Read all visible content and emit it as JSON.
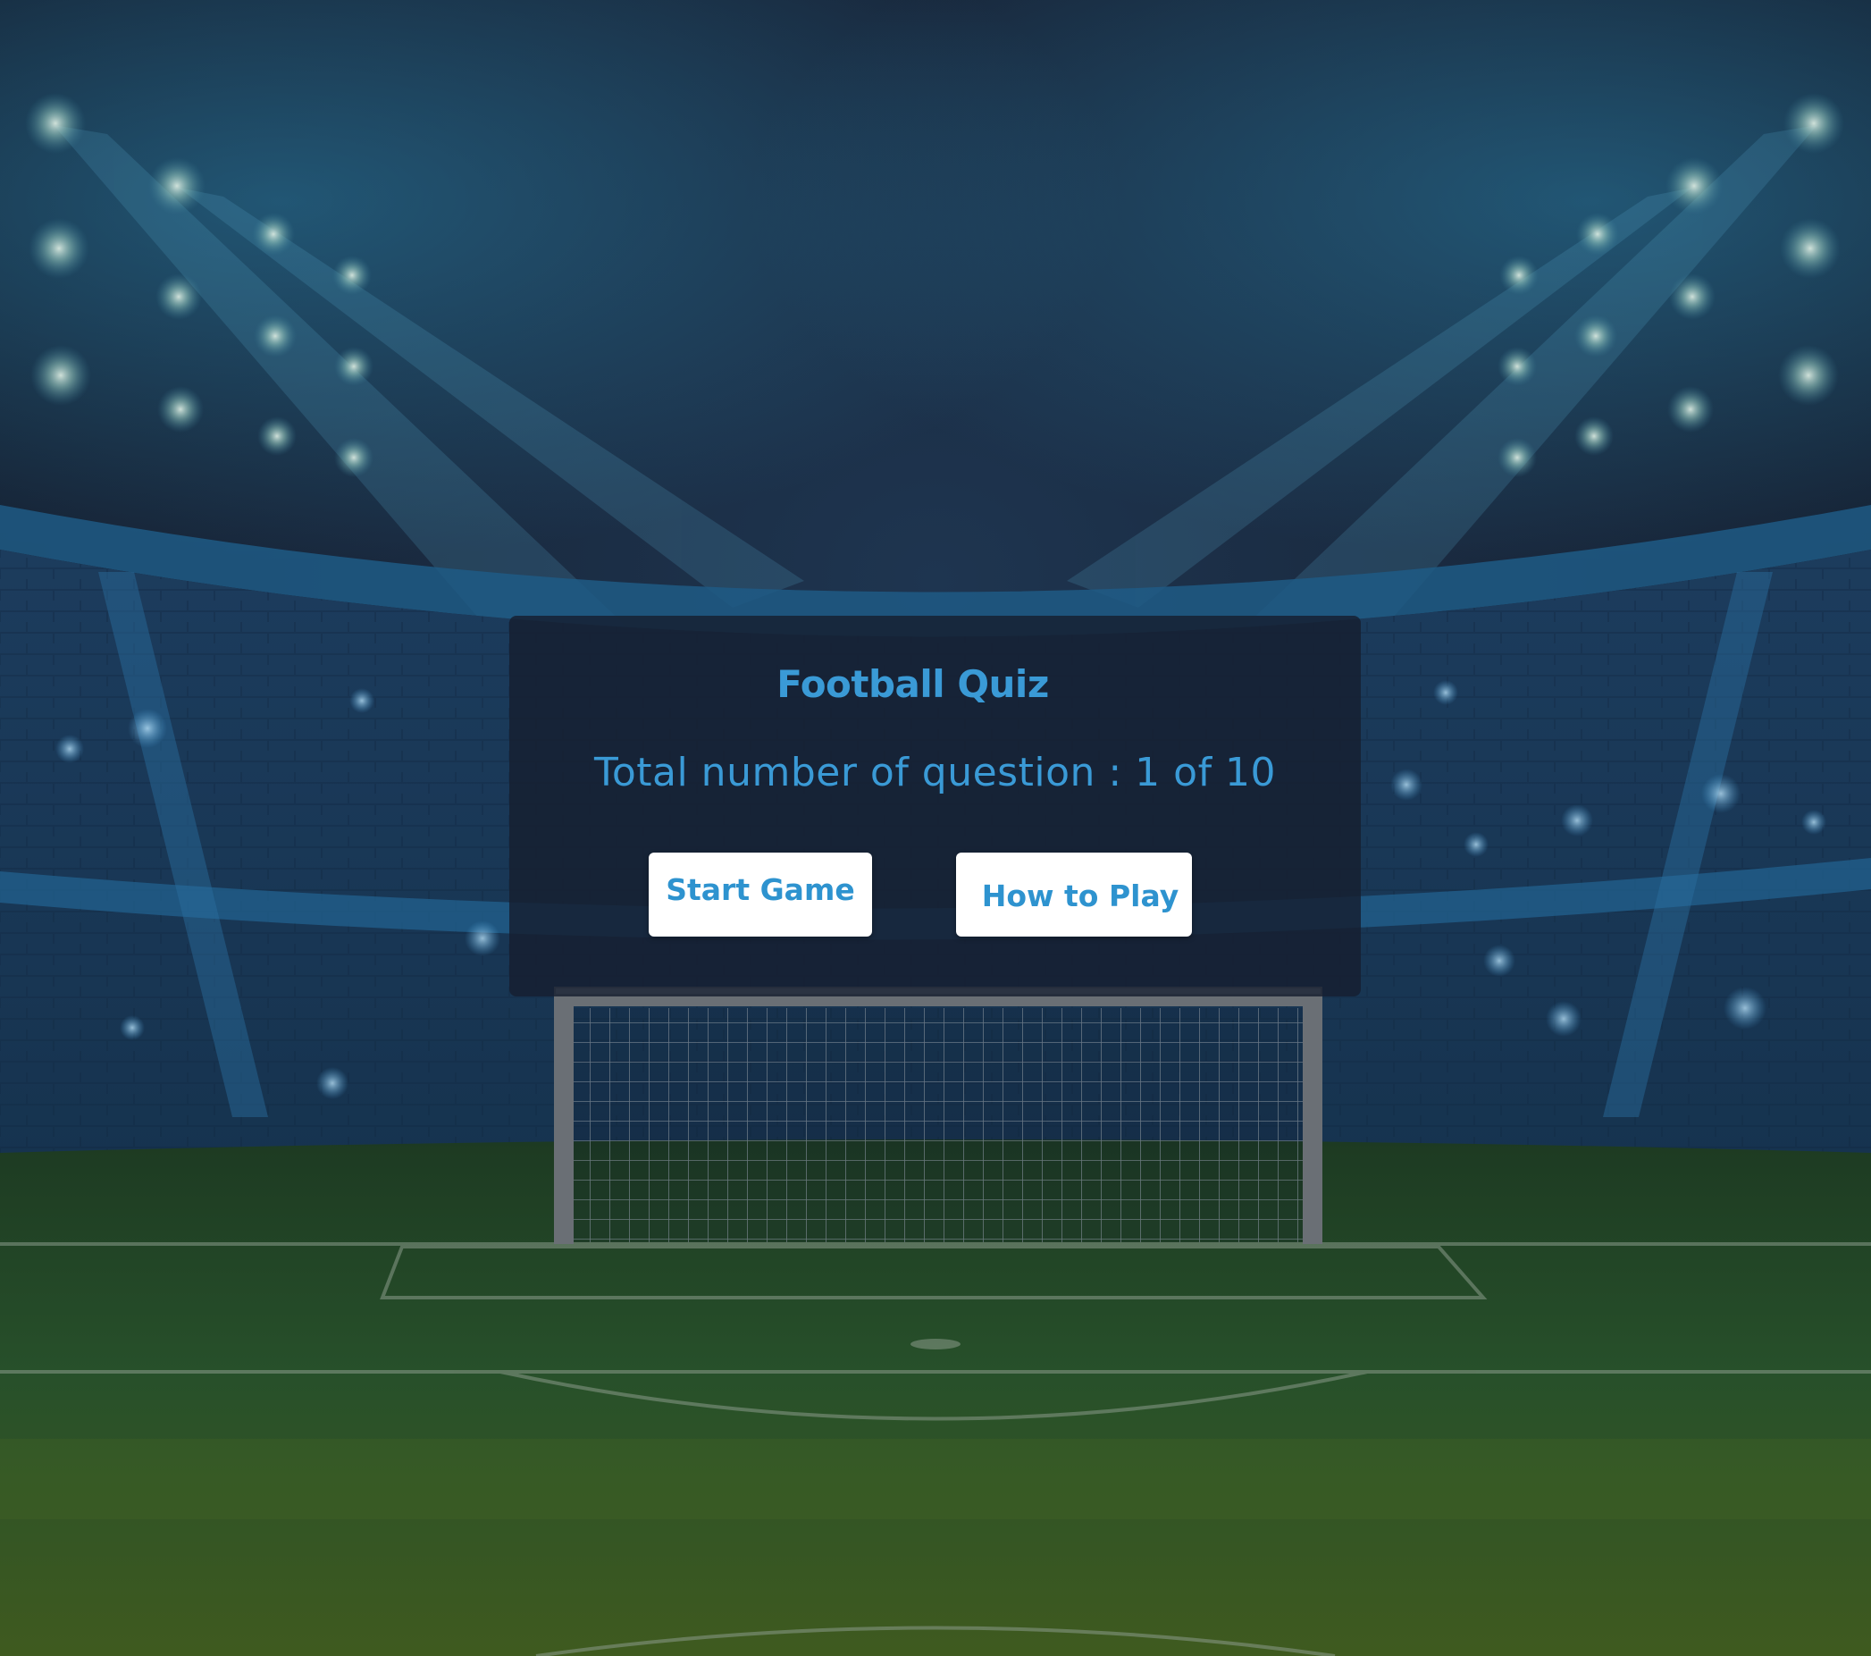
{
  "game": {
    "title": "Football Quiz",
    "question_counter": "Total number of question : 1 of 10",
    "current_question": 1,
    "total_questions": 10
  },
  "buttons": {
    "start_label": "Start Game",
    "how_to_play_label": "How to Play"
  },
  "theme": {
    "accent": "#3a9ad6",
    "button_bg": "#ffffff",
    "panel_bg": "#161e30",
    "sky_dark": "#1a2537",
    "stadium_blue": "#1b4f77",
    "pitch_green": "#2f5a22"
  },
  "icons": [
    "stadium-floodlight-icon",
    "soccer-goal-icon",
    "sparkle-icon"
  ]
}
